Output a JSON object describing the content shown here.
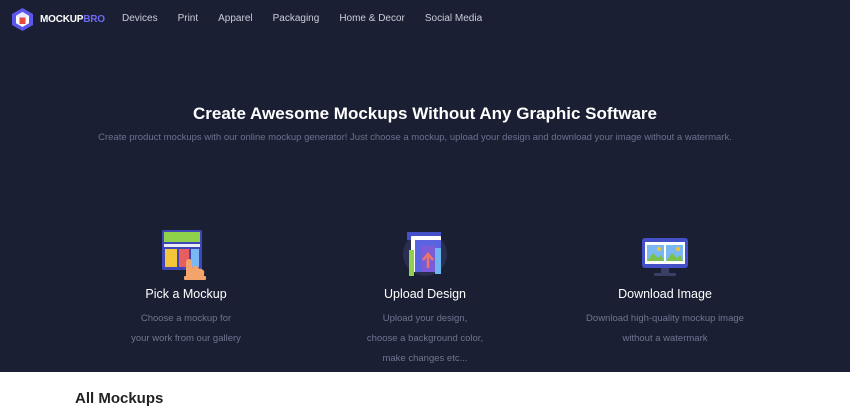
{
  "brand": {
    "name_prefix": "MOCKUP",
    "name_suffix": "BRO",
    "icon": "mockupbro-logo-icon"
  },
  "nav": {
    "items": [
      {
        "label": "Devices"
      },
      {
        "label": "Print"
      },
      {
        "label": "Apparel"
      },
      {
        "label": "Packaging"
      },
      {
        "label": "Home & Decor"
      },
      {
        "label": "Social Media"
      }
    ]
  },
  "hero": {
    "title": "Create Awesome Mockups Without Any Graphic Software",
    "subtitle": "Create product mockups with our online mockup generator! Just choose a mockup, upload your design and download your image without a watermark."
  },
  "steps": [
    {
      "icon": "hand-pick-icon",
      "title": "Pick a Mockup",
      "lines": [
        "Choose a mockup for",
        "your work from our gallery"
      ]
    },
    {
      "icon": "upload-design-icon",
      "title": "Upload Design",
      "lines": [
        "Upload your design,",
        "choose a background color,",
        "make changes etc..."
      ]
    },
    {
      "icon": "download-image-icon",
      "title": "Download Image",
      "lines": [
        "Download high-quality mockup image",
        "without a watermark"
      ]
    }
  ],
  "section": {
    "title": "All Mockups"
  },
  "colors": {
    "hero_bg": "#1b1f33",
    "brand_accent": "#6d6bf5",
    "muted_text": "#6f7691"
  }
}
